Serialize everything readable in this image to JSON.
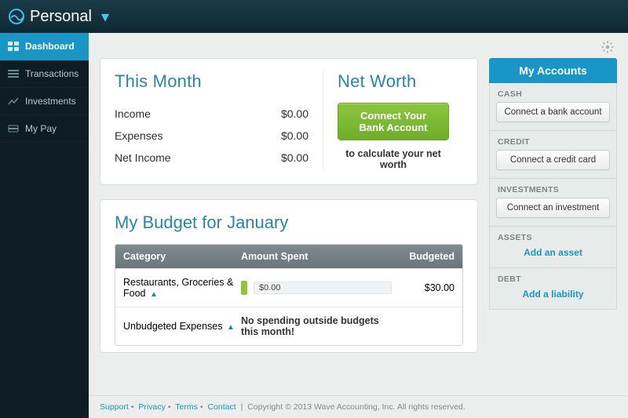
{
  "topbar": {
    "brand": "Personal"
  },
  "sidebar": {
    "items": [
      {
        "label": "Dashboard"
      },
      {
        "label": "Transactions"
      },
      {
        "label": "Investments"
      },
      {
        "label": "My Pay"
      }
    ]
  },
  "this_month": {
    "title": "This Month",
    "rows": [
      {
        "k": "Income",
        "v": "$0.00"
      },
      {
        "k": "Expenses",
        "v": "$0.00"
      },
      {
        "k": "Net Income",
        "v": "$0.00"
      }
    ]
  },
  "net_worth": {
    "title": "Net Worth",
    "cta": "Connect Your Bank Account",
    "sub": "to calculate your net worth"
  },
  "budget": {
    "title": "My Budget for January",
    "columns": {
      "cat": "Category",
      "amt": "Amount Spent",
      "bud": "Budgeted"
    },
    "rows": {
      "r0": {
        "cat": "Restaurants, Groceries & Food",
        "amt": "$0.00",
        "bud": "$30.00"
      },
      "r1": {
        "cat": "Unbudgeted Expenses",
        "msg": "No spending outside budgets this month!"
      }
    }
  },
  "accounts": {
    "title": "My Accounts",
    "groups": {
      "cash": {
        "label": "CASH",
        "action": "Connect a bank account"
      },
      "credit": {
        "label": "CREDIT",
        "action": "Connect a credit card"
      },
      "investments": {
        "label": "INVESTMENTS",
        "action": "Connect an investment"
      },
      "assets": {
        "label": "ASSETS",
        "action": "Add an asset"
      },
      "debt": {
        "label": "DEBT",
        "action": "Add a liability"
      }
    }
  },
  "footer": {
    "links": {
      "support": "Support",
      "privacy": "Privacy",
      "terms": "Terms",
      "contact": "Contact"
    },
    "copy": "Copyright © 2013 Wave Accounting, Inc. All rights reserved."
  }
}
